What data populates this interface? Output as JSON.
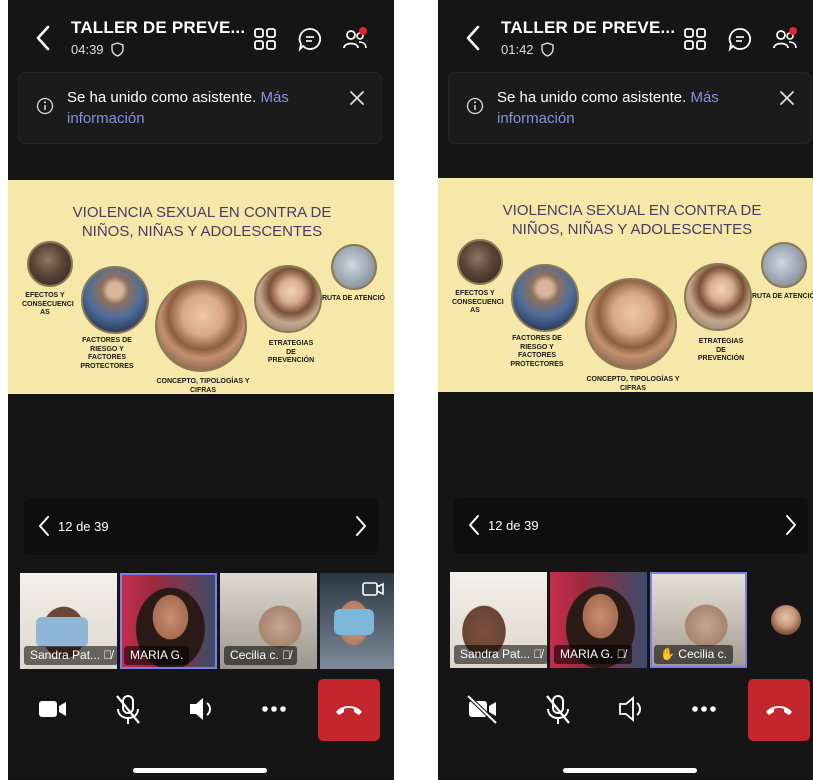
{
  "screens": [
    {
      "header": {
        "title": "TALLER DE PREVE...",
        "time": "04:39"
      },
      "banner": {
        "text": "Se ha unido como asistente.",
        "link": "Más información"
      },
      "slide": {
        "title_line1": "VIOLENCIA SEXUAL EN CONTRA DE",
        "title_line2": "NIÑOS, NIÑAS Y ADOLESCENTES",
        "labels": {
          "efectos": "EFECTOS Y CONSECUENCI AS",
          "factores": "FACTORES DE RIESGO Y FACTORES PROTECTORES",
          "concepto": "CONCEPTO, TIPOLOGÍAS Y CIFRAS",
          "estrategias": "ETRATEGIAS DE PREVENCIÓN",
          "ruta": "RUTA DE ATENCIÓ"
        }
      },
      "pager": {
        "text": "12 de 39"
      },
      "participants": [
        "Sandra Pat...",
        "MARIA G.",
        "Cecilia c.",
        ""
      ]
    },
    {
      "header": {
        "title": "TALLER DE PREVE...",
        "time": "01:42"
      },
      "banner": {
        "text": "Se ha unido como asistente.",
        "link": "Más información"
      },
      "slide": {
        "title_line1": "VIOLENCIA SEXUAL EN CONTRA DE",
        "title_line2": "NIÑOS, NIÑAS Y ADOLESCENTES",
        "labels": {
          "efectos": "EFECTOS Y CONSECUENCI AS",
          "factores": "FACTORES DE RIESGO Y FACTORES PROTECTORES",
          "concepto": "CONCEPTO, TIPOLOGÍAS Y CIFRAS",
          "estrategias": "ETRATEGIAS DE PREVENCIÓN",
          "ruta": "RUTA DE ATENCIÓ"
        }
      },
      "pager": {
        "text": "12 de 39"
      },
      "participants": [
        "Sandra Pat...",
        "MARIA G.",
        "Cecilia c."
      ]
    }
  ],
  "icons": [
    "chevron-left-icon",
    "shield-icon",
    "grid-icon",
    "chat-icon",
    "people-icon",
    "info-icon",
    "close-icon",
    "camera-icon",
    "camera-off-icon",
    "mic-off-icon",
    "speaker-icon",
    "more-icon",
    "hangup-icon",
    "raise-hand-icon",
    "switch-camera-icon"
  ],
  "colors": {
    "background": "#151515",
    "slide": "#f6e8a8",
    "accent": "#7b7de8",
    "hangup": "#c4262e",
    "notify": "#e3262a"
  }
}
